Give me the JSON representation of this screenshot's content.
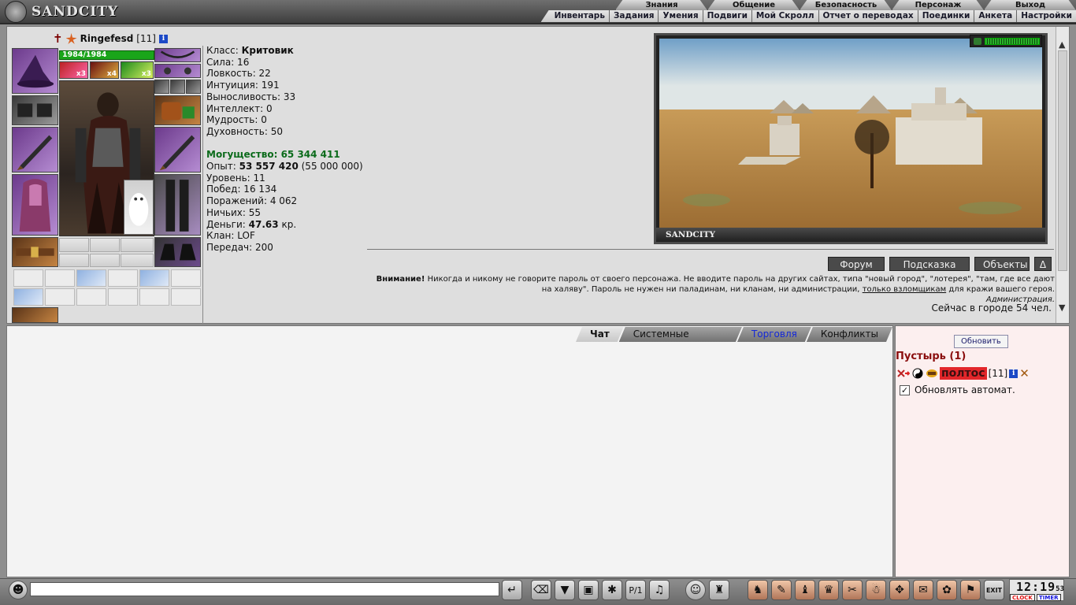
{
  "logo": {
    "text": "SANDCITY"
  },
  "topnav_primary": [
    "Знания",
    "Общение",
    "Безопасность",
    "Персонаж",
    "Выход"
  ],
  "topnav_secondary": [
    "Инвентарь",
    "Задания",
    "Умения",
    "Подвиги",
    "Мой Скролл",
    "Отчет о переводах",
    "Поединки",
    "Анкета",
    "Настройки"
  ],
  "character": {
    "name": "Ringefesd",
    "level_tag": "[11]",
    "hp": "1984/1984",
    "class_label": "Класс:",
    "class_value": "Критовик",
    "stats": [
      "Сила: 16",
      "Ловкость: 22",
      "Интуиция: 191",
      "Выносливость: 33",
      "Интеллект: 0",
      "Мудрость: 0",
      "Духовность: 50"
    ],
    "power": "Могущество: 65 344 411",
    "exp_label": "Опыт:",
    "exp_value": "53 557 420",
    "exp_next": "(55 000 000)",
    "level": "Уровень: 11",
    "wins": "Побед: 16 134",
    "losses": "Поражений: 4 062",
    "draws": "Ничьих: 55",
    "money_label": "Деньги:",
    "money_value": "47.63",
    "money_unit": "кр.",
    "clan": "Клан: LOF",
    "transfers": "Передач: 200",
    "effect_counts": [
      "x3",
      "x4",
      "x3"
    ]
  },
  "location": {
    "caption": "SANDCITY",
    "buttons": [
      "Форум",
      "Подсказка",
      "Объекты",
      "Δ"
    ]
  },
  "warning": {
    "bold": "Внимание!",
    "text1": "Никогда и никому не говорите пароль от своего персонажа. Не вводите пароль на других сайтах, типа \"новый город\", \"лотерея\", \"там, где все дают на халяву\". Пароль не нужен ни паладинам, ни кланам, ни администрации,",
    "link": "только взломщикам",
    "text2": "для кражи вашего героя.",
    "signature": "Администрация."
  },
  "online_text": "Сейчас в городе 54 чел.",
  "chat": {
    "tabs": [
      "Чат",
      "Системные сообщения",
      "Торговля",
      "Конфликты"
    ],
    "input_placeholder": ""
  },
  "online_panel": {
    "refresh": "Обновить",
    "room": "Пустырь (1)",
    "player_name": "полтос",
    "player_level": "[11]",
    "auto_refresh": "Обновлять автомат.",
    "checkmark": "✓"
  },
  "clock": {
    "time": "12:19",
    "seconds": "53",
    "clock_label": "CLOCK",
    "timer_label": "TIMER"
  },
  "icons": {
    "exit": "EXIT"
  },
  "colors": {
    "power": "#0b6b1b",
    "room": "#8a0d0d",
    "nick_bg": "#e2262a",
    "trade_tab": "#1428d8"
  }
}
